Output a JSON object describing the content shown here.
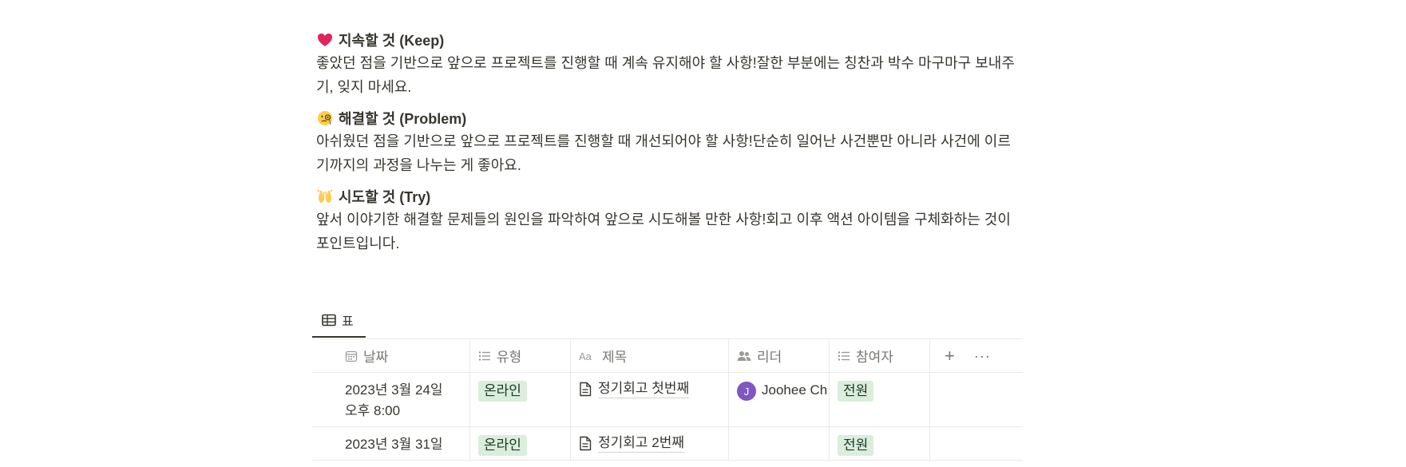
{
  "sections": [
    {
      "icon": "red-heart-icon",
      "title": "지속할 것 (Keep)",
      "body": "좋았던 점을 기반으로 앞으로 프로젝트를 진행할 때 계속 유지해야 할 사항!잘한 부분에는 칭찬과 박수 마구마구 보내주기, 잊지 마세요."
    },
    {
      "icon": "face-with-monocle-icon",
      "title": "해결할 것 (Problem)",
      "body": "아쉬웠던 점을 기반으로 앞으로 프로젝트를 진행할 때 개선되어야 할 사항!단순히 일어난 사건뿐만 아니라 사건에 이르기까지의 과정을 나누는 게 좋아요."
    },
    {
      "icon": "raising-hands-icon",
      "title": "시도할 것 (Try)",
      "body": "앞서 이야기한 해결할 문제들의 원인을 파악하여 앞으로 시도해볼 만한 사항!회고 이후 액션 아이템을 구체화하는 것이 포인트입니다."
    }
  ],
  "view_tab": {
    "icon": "table-icon",
    "label": "표"
  },
  "table": {
    "columns": [
      {
        "icon": "calendar-icon",
        "label": "날짜"
      },
      {
        "icon": "list-icon",
        "label": "유형"
      },
      {
        "icon": "text-aa-icon",
        "label": "제목"
      },
      {
        "icon": "people-icon",
        "label": "리더"
      },
      {
        "icon": "list-icon",
        "label": "참여자"
      }
    ],
    "add_column": "+",
    "more": "···",
    "rows": [
      {
        "date_line1": "2023년 3월 24일",
        "date_line2": "오후 8:00",
        "type": "온라인",
        "title": "정기회고 첫번째",
        "leader_initial": "J",
        "leader_name": "Joohee Ch",
        "participants": "전원"
      },
      {
        "date_line1": "2023년 3월 31일",
        "date_line2": "",
        "type": "온라인",
        "title": "정기회고 2번째",
        "leader_initial": "",
        "leader_name": "",
        "participants": "전원"
      }
    ]
  },
  "colors": {
    "text": "#37352f",
    "muted": "#787774",
    "tag_bg": "#dbeddb",
    "avatar": "#7e57c2",
    "border": "#e9e9e7"
  }
}
